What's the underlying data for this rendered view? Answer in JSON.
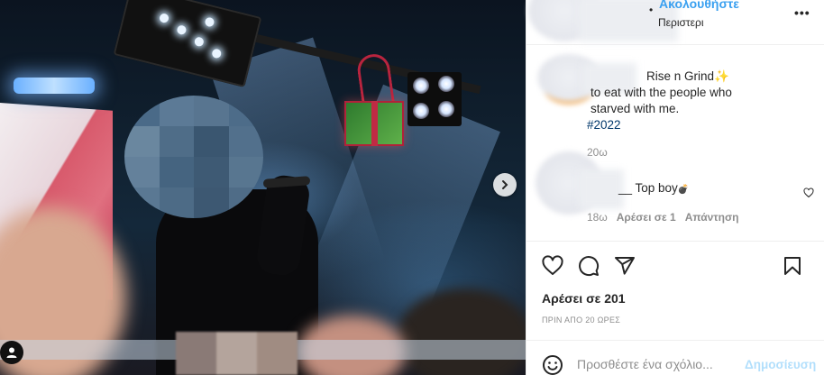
{
  "header": {
    "follow_label": "Ακολουθήστε",
    "separator": "•",
    "location": "Περιστερι",
    "more_label": "•••"
  },
  "caption": {
    "title": "Rise n Grind",
    "sparkle": "✨",
    "body": "to eat with the people who starved with me.",
    "hashtag": "#2022"
  },
  "caption_time": "20ω",
  "comment": {
    "text": "__ Top boy",
    "emoji": "💣",
    "time": "18ω",
    "likes_label": "Αρέσει σε 1",
    "reply_label": "Απάντηση"
  },
  "likes": "Αρέσει σε 201",
  "posted_ago": "ΠΡΙΝ ΑΠΟ 20 ΩΡΕΣ",
  "comment_box": {
    "placeholder": "Προσθέστε ένα σχόλιο...",
    "post_label": "Δημοσίευση"
  },
  "icons": [
    "chevron-right-icon",
    "user-tag-icon",
    "heart-icon",
    "comment-icon",
    "share-icon",
    "bookmark-icon",
    "emoji-icon",
    "more-icon"
  ]
}
